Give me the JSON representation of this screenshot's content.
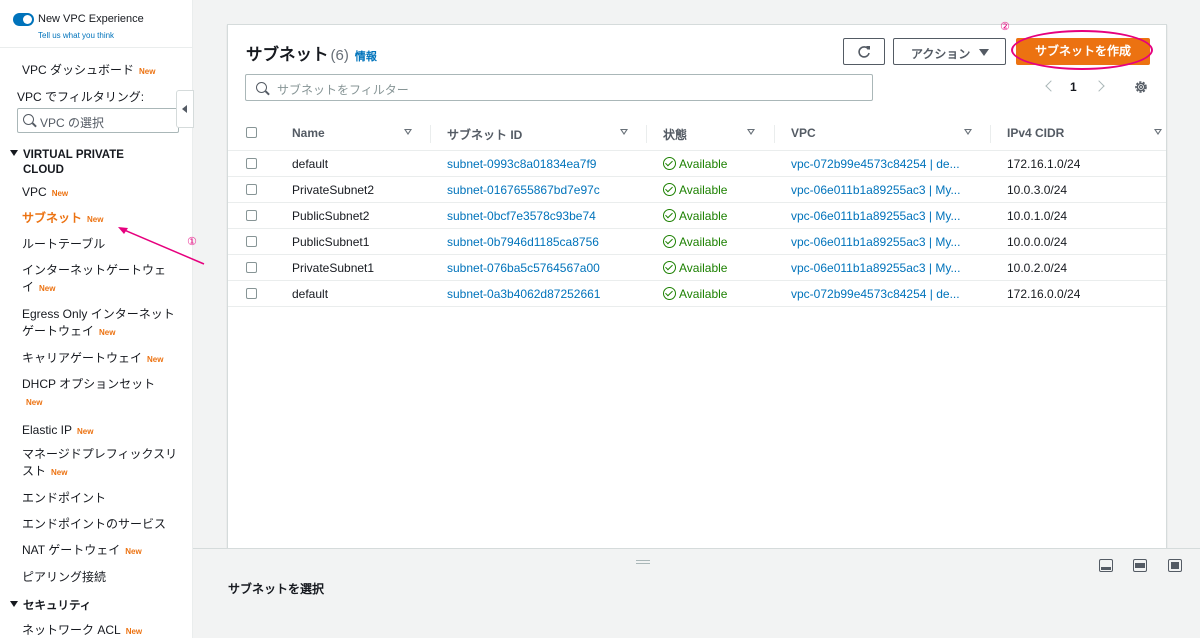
{
  "sidebar": {
    "vpc_experience_title": "New VPC Experience",
    "vpc_experience_link": "Tell us what you think",
    "filter_label": "VPC でフィルタリング:",
    "vpc_select_placeholder": "VPC の選択",
    "new_badge": "New",
    "items": [
      {
        "label": "VPC ダッシュボード",
        "new": true
      },
      {
        "label": "VPC",
        "new": true
      },
      {
        "label": "サブネット",
        "new": true,
        "active": true
      },
      {
        "label": "ルートテーブル",
        "new": false
      },
      {
        "label_line1": "インターネットゲートウェ",
        "label_line2": "イ",
        "new": true
      },
      {
        "label_line1": "Egress Only インターネット",
        "label_line2": "ゲートウェイ",
        "new": true
      },
      {
        "label": "キャリアゲートウェイ",
        "new": true
      },
      {
        "label_line1": "DHCP オプションセット",
        "new": true
      },
      {
        "label": "Elastic IP",
        "new": true
      },
      {
        "label_line1": "マネージドプレフィックスリ",
        "label_line2": "スト",
        "new": true
      },
      {
        "label": "エンドポイント",
        "new": false
      },
      {
        "label": "エンドポイントのサービス",
        "new": false
      },
      {
        "label": "NAT ゲートウェイ",
        "new": true
      },
      {
        "label": "ピアリング接続",
        "new": false
      },
      {
        "label": "ネットワーク ACL",
        "new": true
      }
    ],
    "section_vpc": "VIRTUAL PRIVATE CLOUD",
    "section_vpc_line1": "VIRTUAL PRIVATE",
    "section_vpc_line2": "CLOUD",
    "section_security": "セキュリティ"
  },
  "annotations": {
    "one": "①",
    "two": "②"
  },
  "panel": {
    "title": "サブネット",
    "count": "(6)",
    "info": "情報",
    "actions_label": "アクション",
    "create_label": "サブネットを作成",
    "filter_placeholder": "サブネットをフィルター",
    "page_number": "1"
  },
  "table": {
    "columns": [
      "Name",
      "サブネット ID",
      "状態",
      "VPC",
      "IPv4 CIDR"
    ],
    "rows": [
      {
        "name": "default",
        "id": "subnet-0993c8a01834ea7f9",
        "status": "Available",
        "vpc": "vpc-072b99e4573c84254 | de...",
        "cidr": "172.16.1.0/24"
      },
      {
        "name": "PrivateSubnet2",
        "id": "subnet-0167655867bd7e97c",
        "status": "Available",
        "vpc": "vpc-06e011b1a89255ac3 | My...",
        "cidr": "10.0.3.0/24"
      },
      {
        "name": "PublicSubnet2",
        "id": "subnet-0bcf7e3578c93be74",
        "status": "Available",
        "vpc": "vpc-06e011b1a89255ac3 | My...",
        "cidr": "10.0.1.0/24"
      },
      {
        "name": "PublicSubnet1",
        "id": "subnet-0b7946d1185ca8756",
        "status": "Available",
        "vpc": "vpc-06e011b1a89255ac3 | My...",
        "cidr": "10.0.0.0/24"
      },
      {
        "name": "PrivateSubnet1",
        "id": "subnet-076ba5c5764567a00",
        "status": "Available",
        "vpc": "vpc-06e011b1a89255ac3 | My...",
        "cidr": "10.0.2.0/24"
      },
      {
        "name": "default",
        "id": "subnet-0a3b4062d87252661",
        "status": "Available",
        "vpc": "vpc-072b99e4573c84254 | de...",
        "cidr": "172.16.0.0/24"
      }
    ]
  },
  "split": {
    "title": "サブネットを選択"
  },
  "colors": {
    "accent": "#ec7211",
    "link": "#0073bb",
    "success": "#1d8102",
    "annotation": "#e6007e"
  }
}
